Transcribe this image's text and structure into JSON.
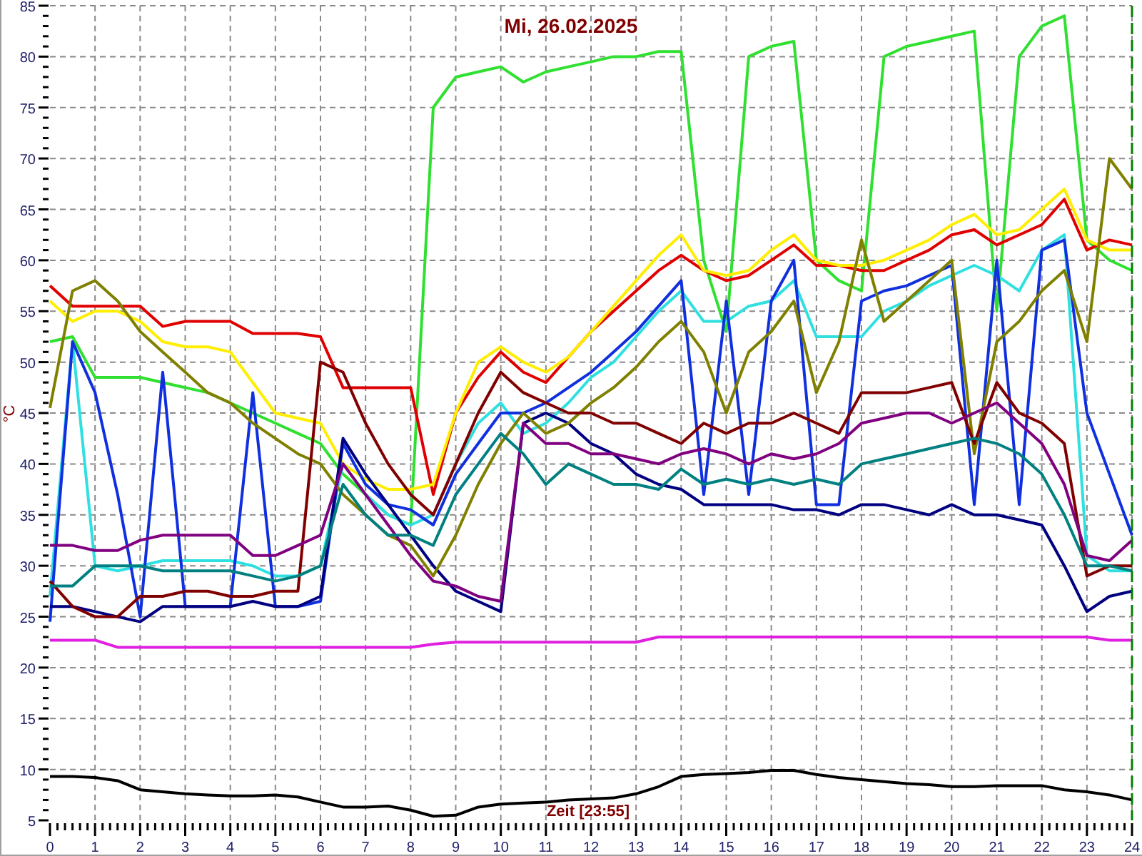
{
  "chart": {
    "chart_data": {
      "type": "line",
      "title": "Mi, 26.02.2025",
      "xlabel": "Zeit [23:55]",
      "ylabel": "°C",
      "x": [
        0,
        0.5,
        1,
        1.5,
        2,
        2.5,
        3,
        3.5,
        4,
        4.5,
        5,
        5.5,
        6,
        6.5,
        7,
        7.5,
        8,
        8.5,
        9,
        9.5,
        10,
        10.5,
        11,
        11.5,
        12,
        12.5,
        13,
        13.5,
        14,
        14.5,
        15,
        15.5,
        16,
        16.5,
        17,
        17.5,
        18,
        18.5,
        19,
        19.5,
        20,
        20.5,
        21,
        21.5,
        22,
        22.5,
        23,
        23.5,
        24
      ],
      "xlim": [
        0,
        24
      ],
      "ylim": [
        5,
        85
      ],
      "xticks": [
        0,
        1,
        2,
        3,
        4,
        5,
        6,
        7,
        8,
        9,
        10,
        11,
        12,
        13,
        14,
        15,
        16,
        17,
        18,
        19,
        20,
        21,
        22,
        23,
        24
      ],
      "yticks": [
        5,
        10,
        15,
        20,
        25,
        30,
        35,
        40,
        45,
        50,
        55,
        60,
        65,
        70,
        75,
        80,
        85
      ],
      "series": [
        {
          "color": "#000000",
          "values": [
            9.3,
            9.3,
            9.2,
            8.9,
            8,
            7.8,
            7.6,
            7.5,
            7.4,
            7.4,
            7.5,
            7.3,
            6.8,
            6.3,
            6.3,
            6.4,
            6,
            5.4,
            5.5,
            6.3,
            6.6,
            6.7,
            6.8,
            7,
            7.1,
            7.2,
            7.6,
            8.3,
            9.3,
            9.5,
            9.6,
            9.7,
            9.9,
            9.9,
            9.5,
            9.2,
            9,
            8.8,
            8.6,
            8.5,
            8.3,
            8.3,
            8.4,
            8.4,
            8.4,
            8,
            7.8,
            7.5,
            7
          ]
        },
        {
          "color": "#e020e0",
          "values": [
            22.7,
            22.7,
            22.7,
            22,
            22,
            22,
            22,
            22,
            22,
            22,
            22,
            22,
            22,
            22,
            22,
            22,
            22,
            22.3,
            22.5,
            22.5,
            22.5,
            22.5,
            22.5,
            22.5,
            22.5,
            22.5,
            22.5,
            23,
            23,
            23,
            23,
            23,
            23,
            23,
            23,
            23,
            23,
            23,
            23,
            23,
            23,
            23,
            23,
            23,
            23,
            23,
            23,
            22.7,
            22.7
          ]
        },
        {
          "color": "#30e030",
          "values": [
            52,
            52.5,
            48.5,
            48.5,
            48.5,
            48,
            47.5,
            47,
            46,
            45,
            44,
            43,
            42,
            39,
            37,
            35,
            34,
            75,
            78,
            78.5,
            79,
            77.5,
            78.5,
            79,
            79.5,
            80,
            80,
            80.5,
            80.5,
            60,
            53,
            80,
            81,
            81.5,
            60,
            58,
            57,
            80,
            81,
            81.5,
            82,
            82.5,
            55,
            80,
            83,
            84,
            62,
            60,
            59
          ]
        },
        {
          "color": "#e00000",
          "values": [
            57.5,
            55.5,
            55.5,
            55.5,
            55.5,
            53.5,
            54,
            54,
            54,
            52.8,
            52.8,
            52.8,
            52.5,
            47.5,
            47.5,
            47.5,
            47.5,
            37,
            45,
            48.5,
            51,
            49,
            48,
            50.5,
            53,
            55,
            57,
            59,
            60.5,
            59,
            58,
            58.5,
            60,
            61.5,
            59.5,
            59.5,
            59,
            59,
            60,
            61,
            62.5,
            63,
            61.5,
            62.5,
            63.5,
            66,
            61,
            62,
            61.5
          ]
        },
        {
          "color": "#ffee00",
          "values": [
            56,
            54,
            55,
            55,
            54,
            52,
            51.5,
            51.5,
            51,
            48,
            45,
            44.5,
            44,
            40,
            38.5,
            37.5,
            37.5,
            38,
            45,
            50,
            51.5,
            50,
            49,
            50.5,
            53,
            55.5,
            58,
            60.5,
            62.5,
            59,
            58.5,
            59,
            61,
            62.5,
            60,
            59.5,
            59.5,
            60,
            61,
            62,
            63.5,
            64.5,
            62.5,
            63,
            65,
            67,
            62,
            61,
            61
          ]
        },
        {
          "color": "#30e0e0",
          "values": [
            27,
            52,
            30,
            29.5,
            30,
            30.5,
            30.5,
            30.5,
            30.5,
            30,
            29,
            29,
            30,
            40,
            37,
            35,
            34,
            35,
            40,
            44,
            46,
            43,
            44,
            46,
            48.5,
            50,
            52.5,
            55,
            57,
            54,
            54,
            55.5,
            56,
            58,
            52.5,
            52.5,
            52.5,
            55,
            56,
            57.5,
            58.5,
            59.5,
            58.5,
            57,
            61,
            62.5,
            31,
            29.5,
            29.5
          ]
        },
        {
          "color": "#1030e0",
          "values": [
            24.5,
            52,
            47,
            37,
            25,
            49,
            26,
            26,
            26,
            47,
            26,
            26,
            26.5,
            42,
            38,
            36,
            35.5,
            34,
            39,
            42,
            45,
            45,
            46,
            47.5,
            49,
            51,
            53,
            55.5,
            58,
            37,
            56,
            37,
            56,
            60,
            36,
            36,
            56,
            57,
            57.5,
            58.5,
            59.5,
            36,
            60,
            36,
            61,
            62,
            45,
            39,
            33
          ]
        },
        {
          "color": "#000080",
          "values": [
            26,
            26,
            25.5,
            25,
            24.5,
            26,
            26,
            26,
            26,
            26.5,
            26,
            26,
            27,
            42.5,
            39,
            36,
            33,
            30,
            27.5,
            26.5,
            25.5,
            44,
            45,
            44,
            42,
            41,
            39,
            38,
            37.5,
            36,
            36,
            36,
            36,
            35.5,
            35.5,
            35,
            36,
            36,
            35.5,
            35,
            36,
            35,
            35,
            34.5,
            34,
            30,
            25.5,
            27,
            27.5
          ]
        },
        {
          "color": "#808000",
          "values": [
            45.5,
            57,
            58,
            56,
            53,
            51,
            49,
            47,
            46,
            44,
            42.5,
            41,
            40,
            37,
            35,
            33,
            32,
            29,
            33,
            38,
            42,
            45,
            43,
            44,
            46,
            47.5,
            49.5,
            52,
            54,
            51,
            45,
            51,
            53,
            56,
            47,
            52,
            62,
            54,
            56,
            58,
            60,
            41,
            52,
            54,
            57,
            59,
            52,
            70,
            67
          ]
        },
        {
          "color": "#800000",
          "values": [
            28.5,
            26,
            25,
            25,
            27,
            27,
            27.5,
            27.5,
            27,
            27,
            27.5,
            27.5,
            50,
            49,
            44,
            40,
            37,
            35,
            40,
            45,
            49,
            47,
            46,
            45,
            45,
            44,
            44,
            43,
            42,
            44,
            43,
            44,
            44,
            45,
            44,
            43,
            47,
            47,
            47,
            47.5,
            48,
            42,
            48,
            45,
            44,
            42,
            29,
            30,
            30
          ]
        },
        {
          "color": "#800080",
          "values": [
            32,
            32,
            31.5,
            31.5,
            32.5,
            33,
            33,
            33,
            33,
            31,
            31,
            32,
            33,
            40,
            37,
            34,
            31,
            28.5,
            28,
            27,
            26.5,
            44,
            42,
            42,
            41,
            41,
            40.5,
            40,
            41,
            41.5,
            41,
            40,
            41,
            40.5,
            41,
            42,
            44,
            44.5,
            45,
            45,
            44,
            45,
            46,
            44,
            42,
            38,
            31,
            30.5,
            32.5
          ]
        },
        {
          "color": "#008080",
          "values": [
            28,
            28,
            30,
            30,
            30,
            29.5,
            29.5,
            29.5,
            29.5,
            29,
            28.5,
            29,
            30,
            38,
            35,
            33,
            33,
            32,
            37,
            40,
            43,
            41,
            38,
            40,
            39,
            38,
            38,
            37.5,
            39.5,
            38,
            38.5,
            38,
            38.5,
            38,
            38.5,
            38,
            40,
            40.5,
            41,
            41.5,
            42,
            42.5,
            42,
            41,
            39,
            35,
            30,
            30,
            29.5
          ]
        }
      ],
      "grid": true
    }
  }
}
